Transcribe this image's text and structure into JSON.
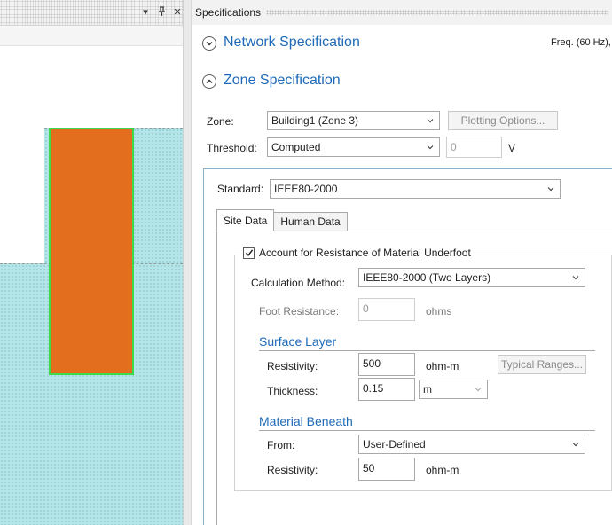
{
  "left_pane": {
    "header_buttons": {
      "dropdown": "▾",
      "pin": "🖈",
      "close": "✕"
    }
  },
  "panel": {
    "title": "Specifications"
  },
  "network": {
    "title": "Network Specification",
    "expanded": false,
    "frequency": "Freq. (60 Hz),"
  },
  "zone_spec": {
    "title": "Zone Specification",
    "expanded": true,
    "zone_label": "Zone:",
    "zone_value": "Building1 (Zone 3)",
    "plotting_options": "Plotting Options...",
    "threshold_label": "Threshold:",
    "threshold_value": "Computed",
    "threshold_input": "0",
    "threshold_unit": "V",
    "standard_label": "Standard:",
    "standard_value": "IEEE80-2000"
  },
  "tabs": [
    {
      "label": "Site Data",
      "active": true
    },
    {
      "label": "Human Data",
      "active": false
    }
  ],
  "site_data": {
    "account_label": "Account for Resistance of Material Underfoot",
    "account_checked": true,
    "calc_method_label": "Calculation Method:",
    "calc_method_value": "IEEE80-2000 (Two Layers)",
    "foot_resistance_label": "Foot Resistance:",
    "foot_resistance_value": "0",
    "foot_resistance_unit": "ohms",
    "surface_layer_title": "Surface Layer",
    "surface_resistivity_label": "Resistivity:",
    "surface_resistivity_value": "500",
    "surface_resistivity_unit": "ohm-m",
    "typical_ranges": "Typical Ranges...",
    "thickness_label": "Thickness:",
    "thickness_value": "0.15",
    "thickness_unit": "m",
    "material_beneath_title": "Material Beneath",
    "from_label": "From:",
    "from_value": "User-Defined",
    "beneath_resistivity_label": "Resistivity:",
    "beneath_resistivity_value": "50",
    "beneath_resistivity_unit": "ohm-m"
  },
  "colors": {
    "accent": "#1e6ab8",
    "building_fill": "#e36f1e",
    "building_outline": "#3ed84a",
    "soil_fill": "#b4e6e9"
  }
}
